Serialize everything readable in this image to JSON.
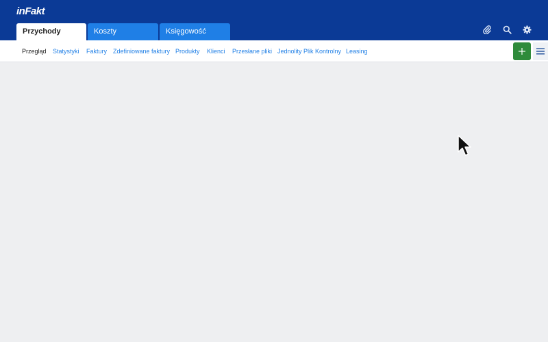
{
  "brand": {
    "logo_text": "inFakt"
  },
  "main_tabs": [
    {
      "label": "Przychody",
      "active": true
    },
    {
      "label": "Koszty",
      "active": false
    },
    {
      "label": "Księgowość",
      "active": false
    }
  ],
  "top_icons": [
    "paperclip-icon",
    "search-icon",
    "gear-icon"
  ],
  "subnav": {
    "items": [
      {
        "label": "Przegląd",
        "current": true
      },
      {
        "label": "Statystyki"
      },
      {
        "label": "Faktury"
      },
      {
        "label": "Zdefiniowane faktury"
      },
      {
        "label": "Produkty"
      },
      {
        "label": "Klienci"
      },
      {
        "label": "Przesłane pliki"
      },
      {
        "label": "Jednolity Plik Kontrolny"
      },
      {
        "label": "Leasing"
      }
    ]
  },
  "actions": {
    "add_icon": "plus-icon",
    "menu_icon": "hamburger-icon"
  },
  "colors": {
    "header_bg": "#0b3a96",
    "tab_inactive": "#1f7fe6",
    "link": "#1f7fe6",
    "add_button": "#2f8b3b",
    "content_bg": "#eeeff1"
  }
}
